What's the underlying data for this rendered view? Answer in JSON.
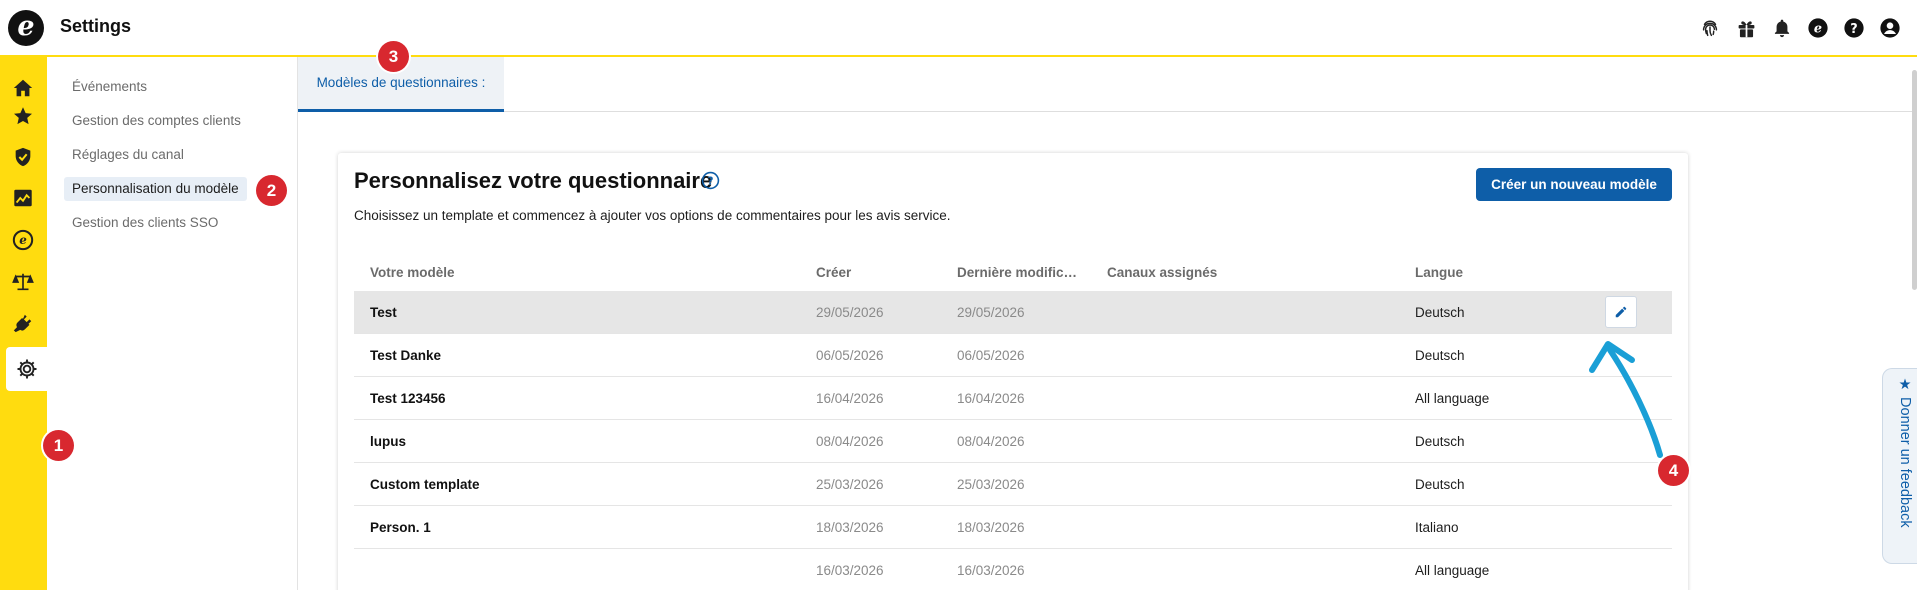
{
  "app": {
    "logo_letter": "e",
    "title": "Settings"
  },
  "top_icons": [
    "fingerprint-icon",
    "gift-icon",
    "bell-icon",
    "trusted-shops-icon",
    "help-icon",
    "account-icon"
  ],
  "rail_icons": [
    "home-icon",
    "star-icon",
    "shield-check-icon",
    "chart-icon",
    "trusted-shops-icon",
    "scales-icon",
    "plug-icon",
    "gear-icon"
  ],
  "subnav": {
    "items": [
      {
        "label": "Événements",
        "active": false
      },
      {
        "label": "Gestion des comptes clients",
        "active": false
      },
      {
        "label": "Réglages du canal",
        "active": false
      },
      {
        "label": "Personnalisation du modèle",
        "active": true
      },
      {
        "label": "Gestion des clients SSO",
        "active": false
      }
    ]
  },
  "tabs": [
    {
      "label": "Modèles de questionnaires :"
    }
  ],
  "card": {
    "title": "Personnalisez votre questionnaire",
    "description": "Choisissez un template et commencez à ajouter vos options de commentaires pour les avis service.",
    "create_button": "Créer un nouveau modèle",
    "columns": [
      "Votre modèle",
      "Créer",
      "Dernière modific…",
      "Canaux assignés",
      "Langue"
    ],
    "rows": [
      {
        "name": "Test",
        "created": "29/05/2026",
        "modified": "29/05/2026",
        "channels": "",
        "language": "Deutsch"
      },
      {
        "name": "Test Danke",
        "created": "06/05/2026",
        "modified": "06/05/2026",
        "channels": "",
        "language": "Deutsch"
      },
      {
        "name": "Test 123456",
        "created": "16/04/2026",
        "modified": "16/04/2026",
        "channels": "",
        "language": "All language"
      },
      {
        "name": "lupus",
        "created": "08/04/2026",
        "modified": "08/04/2026",
        "channels": "",
        "language": "Deutsch"
      },
      {
        "name": "Custom template",
        "created": "25/03/2026",
        "modified": "25/03/2026",
        "channels": "",
        "language": "Deutsch"
      },
      {
        "name": "Person. 1",
        "created": "18/03/2026",
        "modified": "18/03/2026",
        "channels": "",
        "language": "Italiano"
      },
      {
        "name": "",
        "created": "16/03/2026",
        "modified": "16/03/2026",
        "channels": "",
        "language": "All language"
      }
    ]
  },
  "annotations": [
    "1",
    "2",
    "3",
    "4"
  ],
  "feedback": {
    "label": "★ Donner un feedback"
  },
  "colors": {
    "brand_yellow": "#ffdc0f",
    "primary_blue": "#0e5ea8",
    "badge_red": "#d8282f",
    "arrow_blue": "#1a9fd6"
  }
}
